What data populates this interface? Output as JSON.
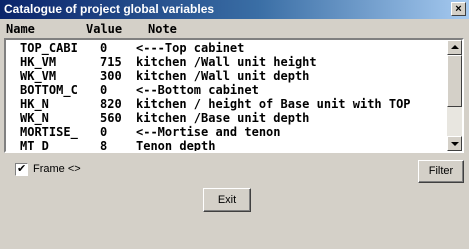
{
  "window": {
    "title": "Catalogue of project global variables",
    "close_glyph": "×"
  },
  "columns": {
    "name": "Name",
    "value": "Value",
    "note": "Note"
  },
  "rows": [
    {
      "name": "TOP_CABI",
      "value": "0",
      "note": "<---Top cabinet"
    },
    {
      "name": "HK_VM",
      "value": "715",
      "note": "kitchen /Wall unit height"
    },
    {
      "name": "WK_VM",
      "value": "300",
      "note": "kitchen /Wall unit depth"
    },
    {
      "name": "BOTTOM_C",
      "value": "0",
      "note": "<--Bottom cabinet"
    },
    {
      "name": "HK_N",
      "value": "820",
      "note": "kitchen / height of Base unit with TOP"
    },
    {
      "name": "WK_N",
      "value": "560",
      "note": "kitchen /Base unit depth"
    },
    {
      "name": "MORTISE_",
      "value": "0",
      "note": "<--Mortise and tenon"
    },
    {
      "name": "MT_D",
      "value": "8",
      "note": "Tenon depth"
    }
  ],
  "frame_checkbox": {
    "label": "Frame <>",
    "checked": true,
    "check_glyph": "✔"
  },
  "buttons": {
    "filter": "Filter",
    "exit": "Exit"
  }
}
